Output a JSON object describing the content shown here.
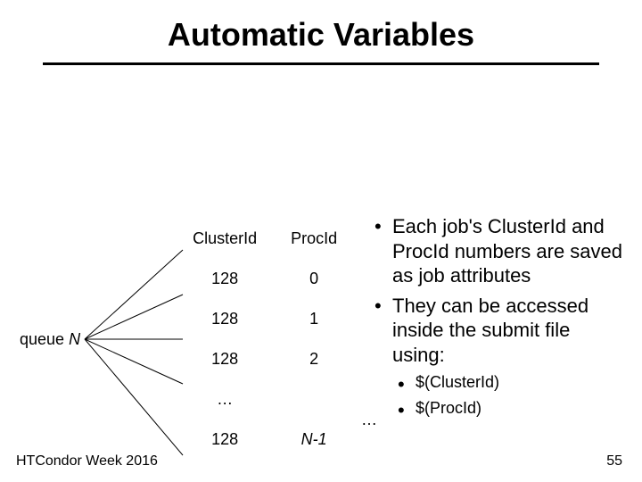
{
  "title": "Automatic Variables",
  "queue_label_prefix": "queue ",
  "queue_label_n": "N",
  "table": {
    "headers": [
      "ClusterId",
      "ProcId"
    ],
    "rows": [
      [
        "128",
        "0"
      ],
      [
        "128",
        "1"
      ],
      [
        "128",
        "2"
      ],
      [
        "…",
        ""
      ],
      [
        "128",
        "N-1"
      ]
    ]
  },
  "ellipsis_right": "…",
  "bullets": [
    "Each job's ClusterId and ProcId numbers are saved as job attributes",
    "They can be accessed inside the submit file using:"
  ],
  "sub_bullets": [
    "$(ClusterId)",
    "$(ProcId)"
  ],
  "footer_left": "HTCondor Week 2016",
  "footer_right": "55"
}
